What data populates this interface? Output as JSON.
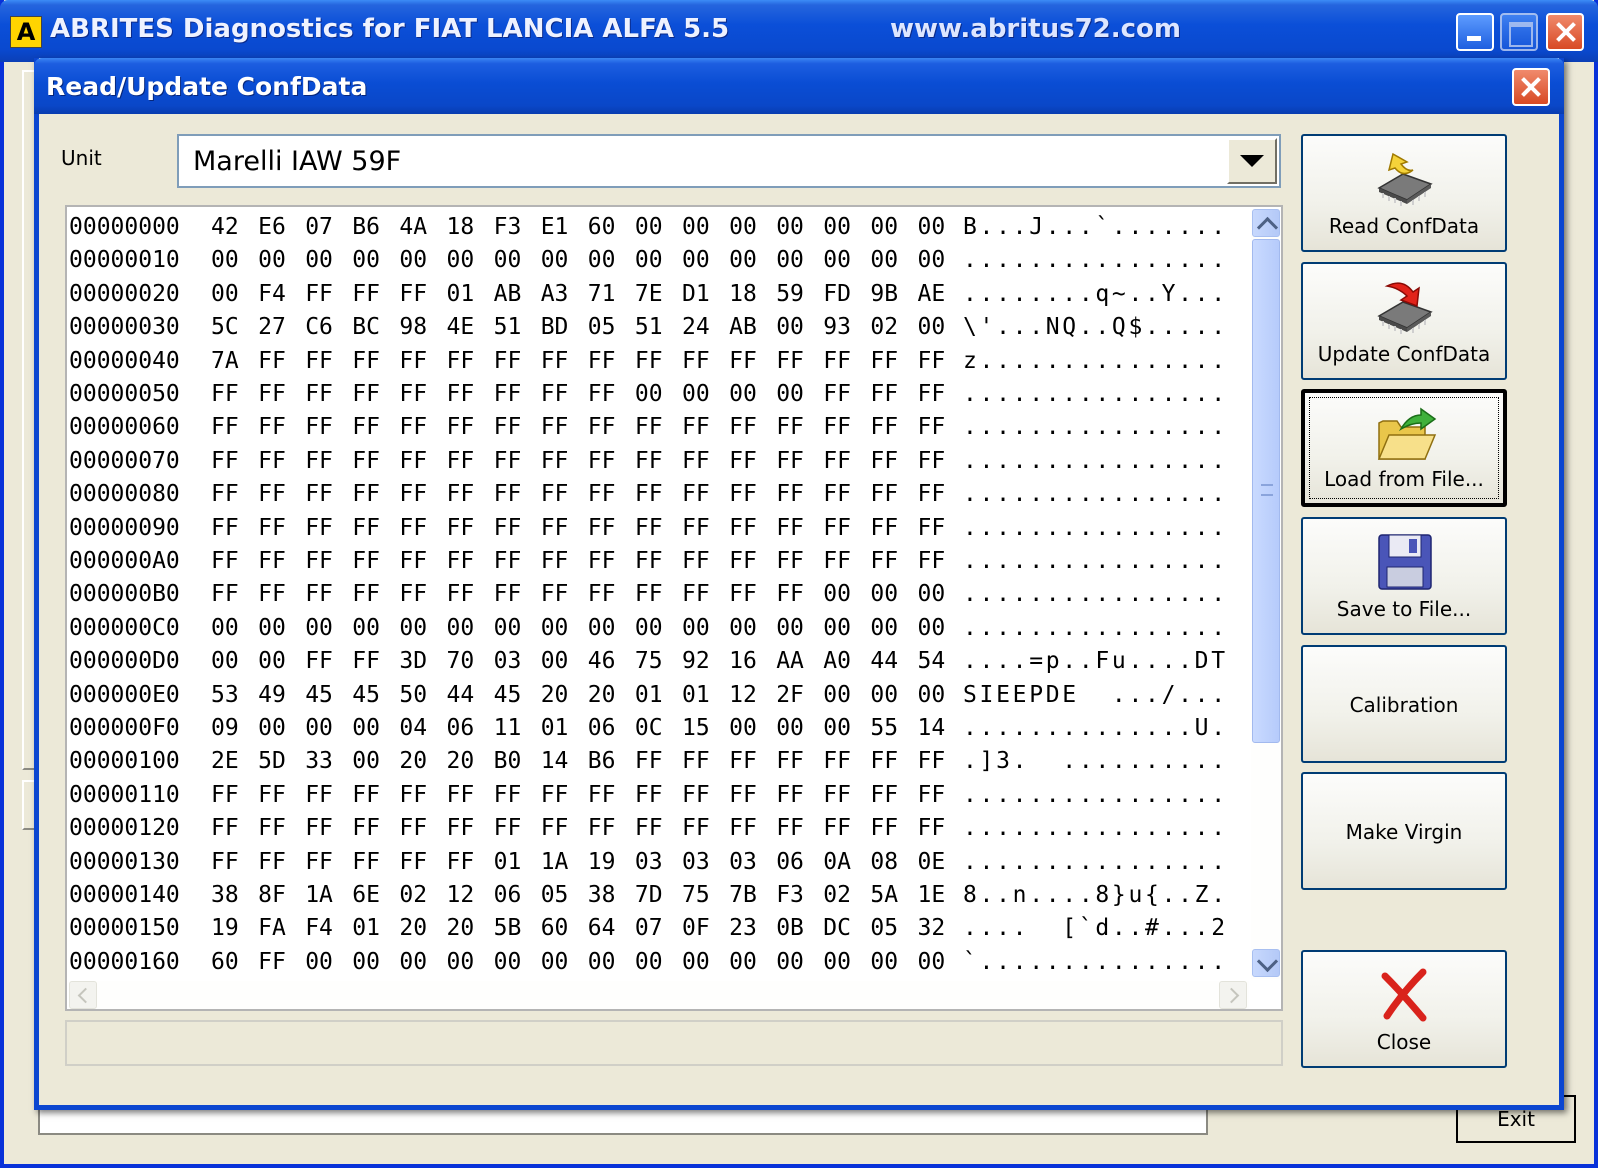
{
  "main_window": {
    "title": "ABRITES Diagnostics for FIAT LANCIA ALFA 5.5",
    "url": "www.abritus72.com",
    "app_icon_letter": "A",
    "exit_label": "Exit"
  },
  "dialog": {
    "title": "Read/Update ConfData",
    "unit_label": "Unit",
    "unit_value": "Marelli IAW 59F",
    "buttons": {
      "read": "Read ConfData",
      "update": "Update ConfData",
      "load": "Load from File...",
      "save": "Save to File...",
      "calibration": "Calibration",
      "make_virgin": "Make Virgin",
      "close": "Close"
    },
    "status_text": ""
  },
  "hex_rows": [
    {
      "addr": "00000000",
      "bytes": [
        "42",
        "E6",
        "07",
        "B6",
        "4A",
        "18",
        "F3",
        "E1",
        "60",
        "00",
        "00",
        "00",
        "00",
        "00",
        "00",
        "00"
      ],
      "ascii": "B...J...`......."
    },
    {
      "addr": "00000010",
      "bytes": [
        "00",
        "00",
        "00",
        "00",
        "00",
        "00",
        "00",
        "00",
        "00",
        "00",
        "00",
        "00",
        "00",
        "00",
        "00",
        "00"
      ],
      "ascii": "................"
    },
    {
      "addr": "00000020",
      "bytes": [
        "00",
        "F4",
        "FF",
        "FF",
        "FF",
        "01",
        "AB",
        "A3",
        "71",
        "7E",
        "D1",
        "18",
        "59",
        "FD",
        "9B",
        "AE"
      ],
      "ascii": "........q~..Y..."
    },
    {
      "addr": "00000030",
      "bytes": [
        "5C",
        "27",
        "C6",
        "BC",
        "98",
        "4E",
        "51",
        "BD",
        "05",
        "51",
        "24",
        "AB",
        "00",
        "93",
        "02",
        "00"
      ],
      "ascii": "\\'...NQ..Q$....."
    },
    {
      "addr": "00000040",
      "bytes": [
        "7A",
        "FF",
        "FF",
        "FF",
        "FF",
        "FF",
        "FF",
        "FF",
        "FF",
        "FF",
        "FF",
        "FF",
        "FF",
        "FF",
        "FF",
        "FF"
      ],
      "ascii": "z..............."
    },
    {
      "addr": "00000050",
      "bytes": [
        "FF",
        "FF",
        "FF",
        "FF",
        "FF",
        "FF",
        "FF",
        "FF",
        "FF",
        "00",
        "00",
        "00",
        "00",
        "FF",
        "FF",
        "FF"
      ],
      "ascii": "................"
    },
    {
      "addr": "00000060",
      "bytes": [
        "FF",
        "FF",
        "FF",
        "FF",
        "FF",
        "FF",
        "FF",
        "FF",
        "FF",
        "FF",
        "FF",
        "FF",
        "FF",
        "FF",
        "FF",
        "FF"
      ],
      "ascii": "................"
    },
    {
      "addr": "00000070",
      "bytes": [
        "FF",
        "FF",
        "FF",
        "FF",
        "FF",
        "FF",
        "FF",
        "FF",
        "FF",
        "FF",
        "FF",
        "FF",
        "FF",
        "FF",
        "FF",
        "FF"
      ],
      "ascii": "................"
    },
    {
      "addr": "00000080",
      "bytes": [
        "FF",
        "FF",
        "FF",
        "FF",
        "FF",
        "FF",
        "FF",
        "FF",
        "FF",
        "FF",
        "FF",
        "FF",
        "FF",
        "FF",
        "FF",
        "FF"
      ],
      "ascii": "................"
    },
    {
      "addr": "00000090",
      "bytes": [
        "FF",
        "FF",
        "FF",
        "FF",
        "FF",
        "FF",
        "FF",
        "FF",
        "FF",
        "FF",
        "FF",
        "FF",
        "FF",
        "FF",
        "FF",
        "FF"
      ],
      "ascii": "................"
    },
    {
      "addr": "000000A0",
      "bytes": [
        "FF",
        "FF",
        "FF",
        "FF",
        "FF",
        "FF",
        "FF",
        "FF",
        "FF",
        "FF",
        "FF",
        "FF",
        "FF",
        "FF",
        "FF",
        "FF"
      ],
      "ascii": "................"
    },
    {
      "addr": "000000B0",
      "bytes": [
        "FF",
        "FF",
        "FF",
        "FF",
        "FF",
        "FF",
        "FF",
        "FF",
        "FF",
        "FF",
        "FF",
        "FF",
        "FF",
        "00",
        "00",
        "00"
      ],
      "ascii": "................"
    },
    {
      "addr": "000000C0",
      "bytes": [
        "00",
        "00",
        "00",
        "00",
        "00",
        "00",
        "00",
        "00",
        "00",
        "00",
        "00",
        "00",
        "00",
        "00",
        "00",
        "00"
      ],
      "ascii": "................"
    },
    {
      "addr": "000000D0",
      "bytes": [
        "00",
        "00",
        "FF",
        "FF",
        "3D",
        "70",
        "03",
        "00",
        "46",
        "75",
        "92",
        "16",
        "AA",
        "A0",
        "44",
        "54"
      ],
      "ascii": "....=p..Fu....DT"
    },
    {
      "addr": "000000E0",
      "bytes": [
        "53",
        "49",
        "45",
        "45",
        "50",
        "44",
        "45",
        "20",
        "20",
        "01",
        "01",
        "12",
        "2F",
        "00",
        "00",
        "00"
      ],
      "ascii": "SIEEPDE  .../..."
    },
    {
      "addr": "000000F0",
      "bytes": [
        "09",
        "00",
        "00",
        "00",
        "04",
        "06",
        "11",
        "01",
        "06",
        "0C",
        "15",
        "00",
        "00",
        "00",
        "55",
        "14"
      ],
      "ascii": "..............U."
    },
    {
      "addr": "00000100",
      "bytes": [
        "2E",
        "5D",
        "33",
        "00",
        "20",
        "20",
        "B0",
        "14",
        "B6",
        "FF",
        "FF",
        "FF",
        "FF",
        "FF",
        "FF",
        "FF"
      ],
      "ascii": ".]3.  .........."
    },
    {
      "addr": "00000110",
      "bytes": [
        "FF",
        "FF",
        "FF",
        "FF",
        "FF",
        "FF",
        "FF",
        "FF",
        "FF",
        "FF",
        "FF",
        "FF",
        "FF",
        "FF",
        "FF",
        "FF"
      ],
      "ascii": "................"
    },
    {
      "addr": "00000120",
      "bytes": [
        "FF",
        "FF",
        "FF",
        "FF",
        "FF",
        "FF",
        "FF",
        "FF",
        "FF",
        "FF",
        "FF",
        "FF",
        "FF",
        "FF",
        "FF",
        "FF"
      ],
      "ascii": "................"
    },
    {
      "addr": "00000130",
      "bytes": [
        "FF",
        "FF",
        "FF",
        "FF",
        "FF",
        "FF",
        "01",
        "1A",
        "19",
        "03",
        "03",
        "03",
        "06",
        "0A",
        "08",
        "0E"
      ],
      "ascii": "................"
    },
    {
      "addr": "00000140",
      "bytes": [
        "38",
        "8F",
        "1A",
        "6E",
        "02",
        "12",
        "06",
        "05",
        "38",
        "7D",
        "75",
        "7B",
        "F3",
        "02",
        "5A",
        "1E"
      ],
      "ascii": "8..n....8}u{..Z."
    },
    {
      "addr": "00000150",
      "bytes": [
        "19",
        "FA",
        "F4",
        "01",
        "20",
        "20",
        "5B",
        "60",
        "64",
        "07",
        "0F",
        "23",
        "0B",
        "DC",
        "05",
        "32"
      ],
      "ascii": "....  [`d..#...2"
    },
    {
      "addr": "00000160",
      "bytes": [
        "60",
        "FF",
        "00",
        "00",
        "00",
        "00",
        "00",
        "00",
        "00",
        "00",
        "00",
        "00",
        "00",
        "00",
        "00",
        "00"
      ],
      "ascii": "`..............."
    }
  ],
  "icons": {
    "read": "chip-with-arrow-icon",
    "update": "chip-with-red-arrow-icon",
    "load": "open-folder-icon",
    "save": "floppy-disk-icon",
    "close": "red-x-icon"
  },
  "colors": {
    "titlebar_blue": "#0a4dd4",
    "dialog_bg": "#ece9d8",
    "close_red": "#d84a25"
  }
}
